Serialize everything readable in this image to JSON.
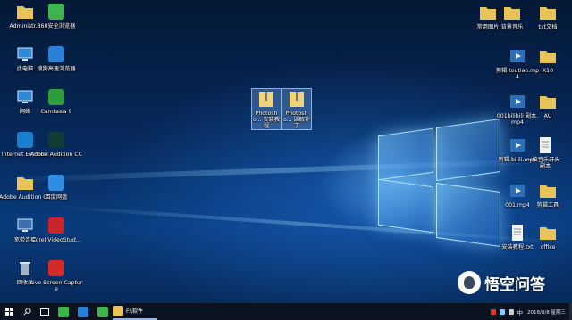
{
  "desktop": {
    "left_icons": [
      {
        "label": "Administr...",
        "icon": "user-folder-icon",
        "color": "#e8c35a"
      },
      {
        "label": "360安全浏览器",
        "icon": "browser-360-icon",
        "color": "#3fb34f"
      },
      {
        "label": "此电脑",
        "icon": "computer-icon",
        "color": "#2a8ad8"
      },
      {
        "label": "搜狗高速浏览器",
        "icon": "sogou-browser-icon",
        "color": "#2a7fd6"
      },
      {
        "label": "网络",
        "icon": "network-icon",
        "color": "#2a8ad8"
      },
      {
        "label": "Camtasia 9",
        "icon": "camtasia-icon",
        "color": "#2e9e3c"
      },
      {
        "label": "Internet Explorer",
        "icon": "ie-icon",
        "color": "#1b7fd0"
      },
      {
        "label": "Adobe Audition CC",
        "icon": "audition-icon",
        "color": "#123d37"
      },
      {
        "label": "Adobe Audition CC",
        "icon": "audition-shortcut-icon",
        "color": "#e8c35a"
      },
      {
        "label": "百度网盘",
        "icon": "baidu-netdisk-icon",
        "color": "#2f8de4"
      },
      {
        "label": "宽带连接",
        "icon": "broadband-icon",
        "color": "#3c6fb0"
      },
      {
        "label": "Corel VideoStud...",
        "icon": "corel-icon",
        "color": "#c9262c"
      },
      {
        "label": "回收站",
        "icon": "recycle-bin-icon",
        "color": "#9fb3c8"
      },
      {
        "label": "Live Screen Capture",
        "icon": "screen-capture-icon",
        "color": "#d42a2a"
      }
    ],
    "center_icons": [
      {
        "label": "Photosho... 安装教程",
        "icon": "zip-folder-icon",
        "color": "#f0d27a"
      },
      {
        "label": "Photosho... 破解补丁",
        "icon": "zip-folder-icon",
        "color": "#f0d27a"
      }
    ],
    "right_icons": [
      {
        "label": "常用图片",
        "icon": "folder-icon",
        "color": "#e8c35a"
      },
      {
        "label": "背景音乐",
        "icon": "folder-icon",
        "color": "#e8c35a"
      },
      {
        "label": "txt文档",
        "icon": "folder-icon",
        "color": "#e8c35a"
      },
      {
        "label": "剪辑 toutiao.mp4",
        "icon": "video-file-icon",
        "color": "#2a6fb8"
      },
      {
        "label": "X10",
        "icon": "folder-icon",
        "color": "#e8c35a"
      },
      {
        "label": "001bilibili 副本.mp4",
        "icon": "video-file-icon",
        "color": "#2a6fb8"
      },
      {
        "label": "AU",
        "icon": "folder-icon",
        "color": "#e8c35a"
      },
      {
        "label": "剪辑 bilili.mp4",
        "icon": "video-file-icon",
        "color": "#2a6fb8"
      },
      {
        "label": "一拍音乐开头 - 副本",
        "icon": "text-file-icon",
        "color": "#f2f2f2"
      },
      {
        "label": "001.mp4",
        "icon": "video-file-icon",
        "color": "#2a6fb8"
      },
      {
        "label": "剪辑工具",
        "icon": "folder-icon",
        "color": "#e8c35a"
      },
      {
        "label": "安装教程.txt",
        "icon": "text-file-icon",
        "color": "#f2f2f2"
      },
      {
        "label": "office",
        "icon": "folder-icon",
        "color": "#e8c35a"
      }
    ]
  },
  "taskbar": {
    "apps": [
      {
        "icon": "wechat-icon",
        "color": "#3bb54a"
      },
      {
        "icon": "sogou-browser-icon",
        "color": "#2a7fd6"
      },
      {
        "icon": "browser-360-icon",
        "color": "#3fb34f"
      },
      {
        "icon": "file-explorer-icon",
        "color": "#e8c35a"
      }
    ],
    "explorer_label": "F:\\软件",
    "tray": {
      "ime": "中",
      "date": "2018/8/8 星期三"
    }
  },
  "watermark": {
    "text": "悟空问答"
  }
}
